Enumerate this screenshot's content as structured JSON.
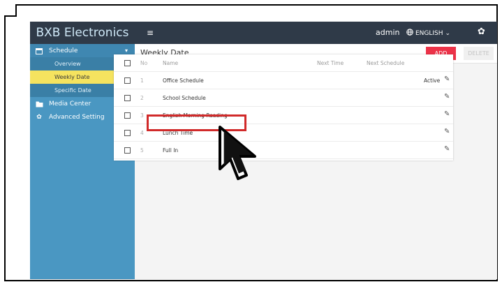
{
  "brand": "BXB Electronics",
  "sidebar": {
    "items": [
      {
        "label": "Schedule",
        "icon": "calendar-icon",
        "arrow": "▾",
        "children": [
          {
            "label": "Overview"
          },
          {
            "label": "Weekly Date"
          },
          {
            "label": "Specific Date"
          }
        ]
      },
      {
        "label": "Media Center",
        "icon": "folder-icon",
        "arrow": "▸"
      },
      {
        "label": "Advanced Setting",
        "icon": "gear-icon",
        "arrow": "▸"
      }
    ]
  },
  "topbar": {
    "menu_icon": "≡",
    "user": "admin",
    "language": "ENGLISH"
  },
  "page": {
    "title": "Weekly Date",
    "add_label": "ADD",
    "delete_label": "DELETE"
  },
  "table": {
    "headers": {
      "no": "No",
      "name": "Name",
      "next_time": "Next Time",
      "next_schedule": "Next Schedule"
    },
    "rows": [
      {
        "no": "1",
        "name": "Office Schedule",
        "status": "Active"
      },
      {
        "no": "2",
        "name": "School Schedule",
        "status": ""
      },
      {
        "no": "3",
        "name": "English Morning Reading",
        "status": ""
      },
      {
        "no": "4",
        "name": "Lunch Time",
        "status": ""
      },
      {
        "no": "5",
        "name": "Full In",
        "status": ""
      }
    ]
  },
  "colors": {
    "sidebar": "#4a97c2",
    "topbar": "#2f3a48",
    "active_item": "#f5e35f",
    "add_button": "#ec3248",
    "highlight": "#d12a2a"
  }
}
